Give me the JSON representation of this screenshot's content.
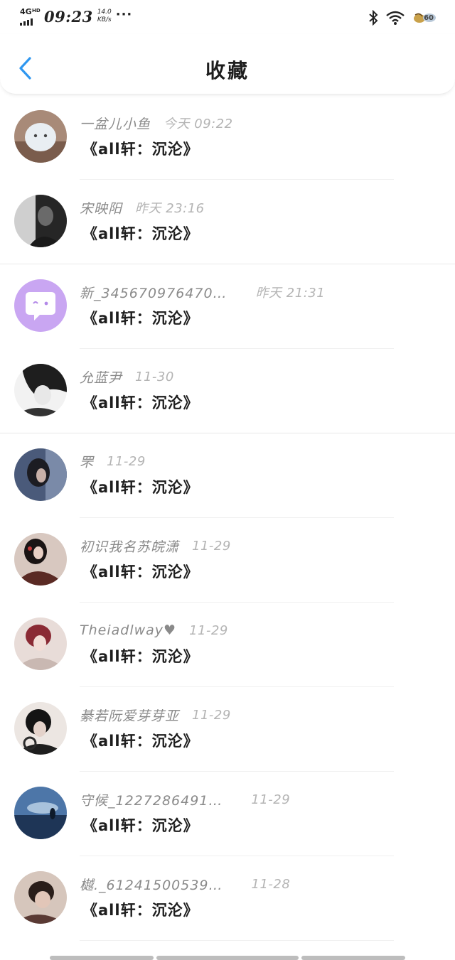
{
  "status_bar": {
    "network": "4G",
    "network_sup": "HD",
    "time": "09:23",
    "speed_value": "14.0",
    "speed_unit": "KB/s",
    "more": "···",
    "battery": "60",
    "icons": [
      "signal-icon",
      "bluetooth-icon",
      "wifi-icon",
      "battery-icon"
    ]
  },
  "header": {
    "title": "收藏",
    "back_icon": "chevron-left-icon",
    "accent_color": "#2f97f0"
  },
  "items": [
    {
      "name": "一盆儿小鱼",
      "time": "今天 09:22",
      "title": "《all轩：沉沦》",
      "avatar_color": "#b08f7a"
    },
    {
      "name": "宋映阳",
      "time": "昨天 23:16",
      "title": "《all轩：沉沦》",
      "avatar_color": "#4a4a4a"
    },
    {
      "name": "新_345670976470…",
      "time": "昨天 21:31",
      "title": "《all轩：沉沦》",
      "avatar_color": "#c9a6f2"
    },
    {
      "name": "允蓝尹",
      "time": "11-30",
      "title": "《all轩：沉沦》",
      "avatar_color": "#2e2e2e"
    },
    {
      "name": "罘",
      "time": "11-29",
      "title": "《all轩：沉沦》",
      "avatar_color": "#3d4a66"
    },
    {
      "name": "初识我名苏皖潇",
      "time": "11-29",
      "title": "《all轩：沉沦》",
      "avatar_color": "#5a3630"
    },
    {
      "name": "Theiadlway♥",
      "time": "11-29",
      "title": "《all轩：沉沦》",
      "avatar_color": "#b04a5a"
    },
    {
      "name": "綦若阮爱芽芽亚",
      "time": "11-29",
      "title": "《all轩：沉沦》",
      "avatar_color": "#2a2a2a"
    },
    {
      "name": "守候_1227286491…",
      "time": "11-29",
      "title": "《all轩：沉沦》",
      "avatar_color": "#2f5486"
    },
    {
      "name": "樾._61241500539…",
      "time": "11-28",
      "title": "《all轩：沉沦》",
      "avatar_color": "#6a4f48"
    }
  ]
}
